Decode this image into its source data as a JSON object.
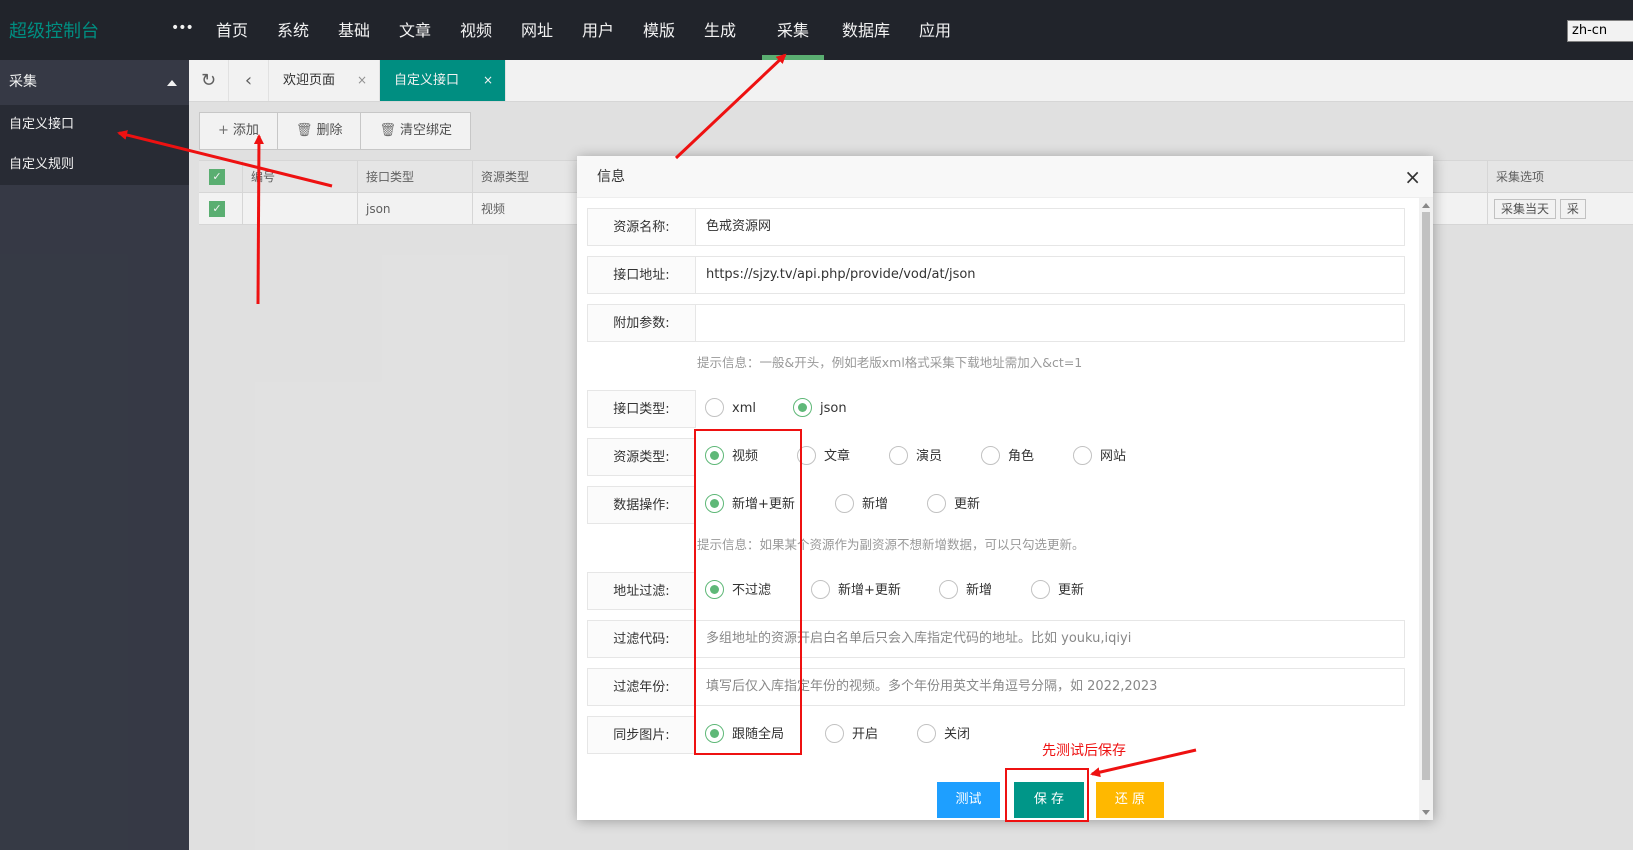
{
  "app": {
    "title": "超级控制台",
    "more": "•••",
    "lang": "zh-cn"
  },
  "nav": [
    {
      "label": "首页"
    },
    {
      "label": "系统"
    },
    {
      "label": "基础"
    },
    {
      "label": "文章"
    },
    {
      "label": "视频"
    },
    {
      "label": "网址"
    },
    {
      "label": "用户"
    },
    {
      "label": "模版"
    },
    {
      "label": "生成"
    },
    {
      "label": "采集"
    },
    {
      "label": "数据库"
    },
    {
      "label": "应用"
    }
  ],
  "sidebar": {
    "group": "采集",
    "items": [
      {
        "label": "自定义接口"
      },
      {
        "label": "自定义规则"
      }
    ]
  },
  "tabs": [
    {
      "label": "欢迎页面",
      "close": "×"
    },
    {
      "label": "自定义接口",
      "close": "×"
    }
  ],
  "toolbar": {
    "add": "添加",
    "delete": "删除",
    "clear": "清空绑定"
  },
  "grid": {
    "headers": {
      "id": "编号",
      "api_type": "接口类型",
      "res_type": "资源类型",
      "options": "采集选项"
    },
    "row": {
      "api_type": "json",
      "res_type": "视频",
      "opt1": "采集当天",
      "opt2": "采"
    }
  },
  "modal": {
    "title": "信息",
    "close": "×",
    "fields": {
      "name_label": "资源名称:",
      "name_value": "色戒资源网",
      "url_label": "接口地址:",
      "url_value": "https://sjzy.tv/api.php/provide/vod/at/json",
      "param_label": "附加参数:",
      "param_value": "",
      "param_hint": "提示信息：一般&开头，例如老版xml格式采集下载地址需加入&ct=1",
      "api_type_label": "接口类型:",
      "api_type_options": [
        "xml",
        "json"
      ],
      "api_type_selected": "json",
      "res_type_label": "资源类型:",
      "res_type_options": [
        "视频",
        "文章",
        "演员",
        "角色",
        "网站"
      ],
      "res_type_selected": "视频",
      "op_label": "数据操作:",
      "op_options": [
        "新增+更新",
        "新增",
        "更新"
      ],
      "op_selected": "新增+更新",
      "op_hint": "提示信息：如果某个资源作为副资源不想新增数据，可以只勾选更新。",
      "url_filter_label": "地址过滤:",
      "url_filter_options": [
        "不过滤",
        "新增+更新",
        "新增",
        "更新"
      ],
      "url_filter_selected": "不过滤",
      "filter_code_label": "过滤代码:",
      "filter_code_placeholder": "多组地址的资源开启白名单后只会入库指定代码的地址。比如 youku,iqiyi",
      "filter_year_label": "过滤年份:",
      "filter_year_placeholder": "填写后仅入库指定年份的视频。多个年份用英文半角逗号分隔，如 2022,2023",
      "sync_pic_label": "同步图片:",
      "sync_pic_options": [
        "跟随全局",
        "开启",
        "关闭"
      ],
      "sync_pic_selected": "跟随全局"
    },
    "buttons": {
      "test": "测试",
      "save": "保 存",
      "reset": "还 原"
    }
  },
  "annotation": {
    "note": "先测试后保存",
    "color": "#ee1111"
  },
  "colors": {
    "primary": "#009688",
    "green": "#5fb878",
    "blue": "#1e9fff",
    "orange": "#ffb800",
    "topbar": "#23262e",
    "sidebar": "#393d49"
  }
}
